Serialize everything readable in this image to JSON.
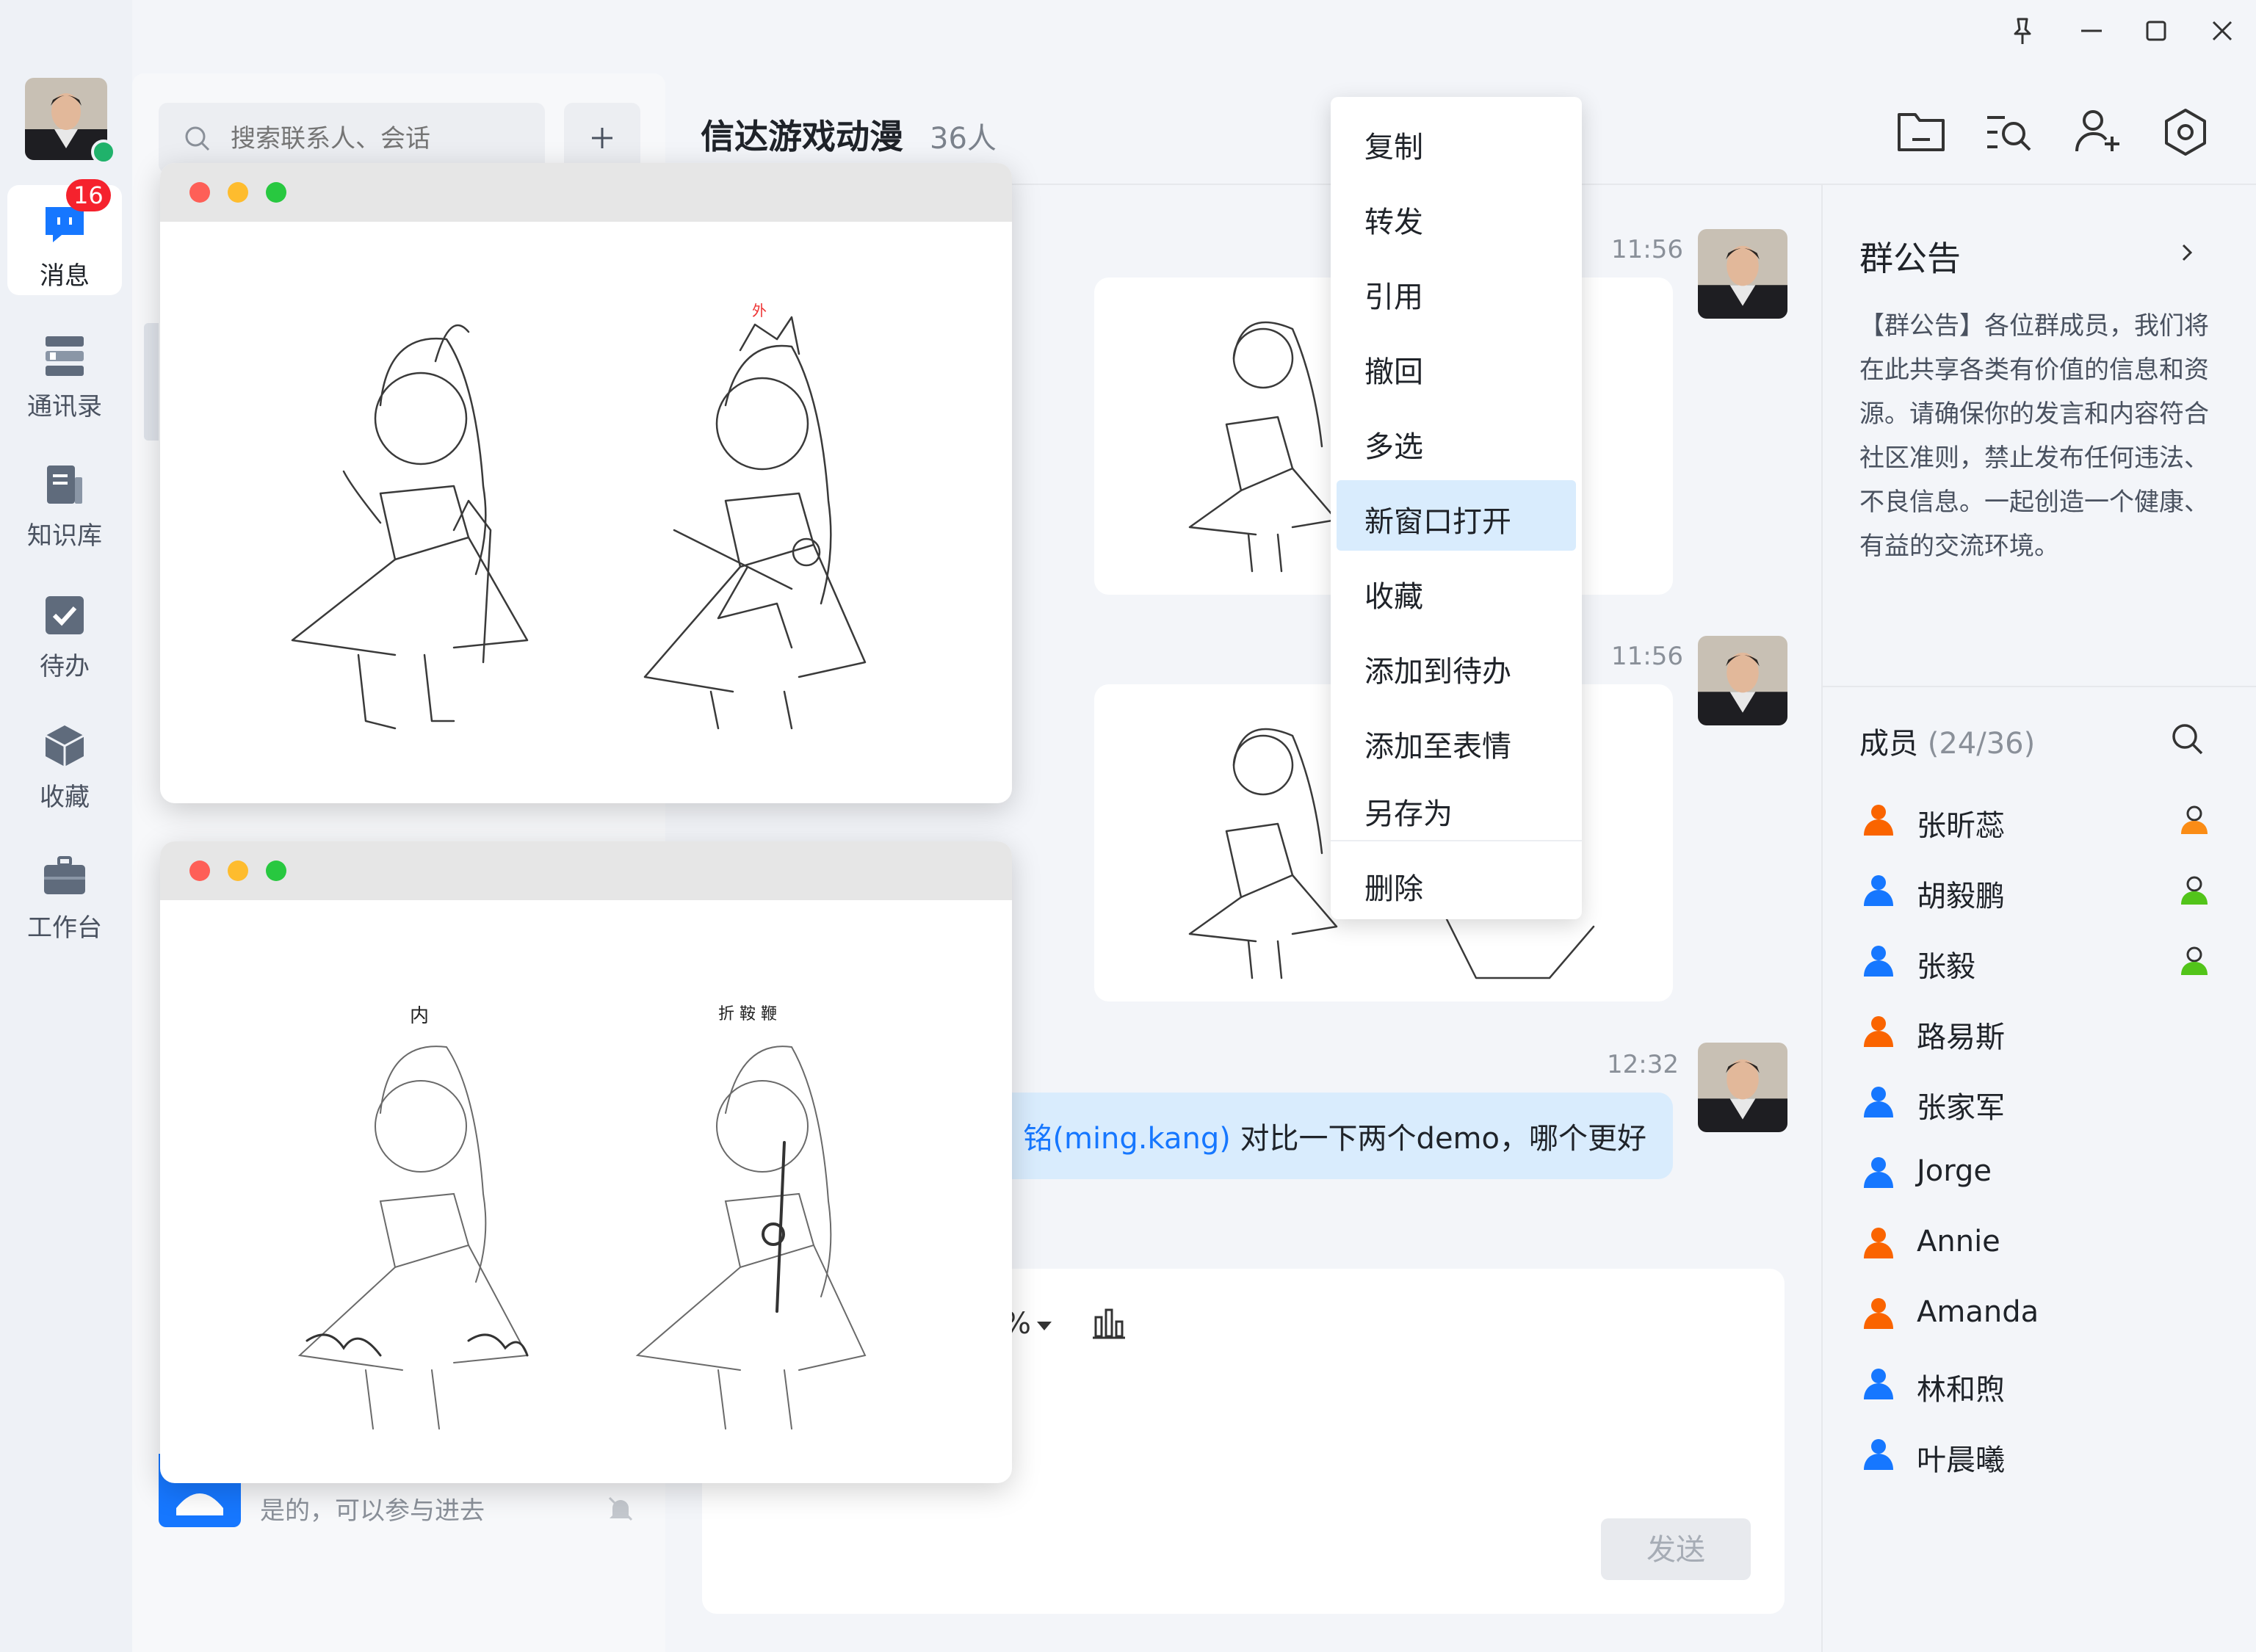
{
  "nav": {
    "badge": "16",
    "items": [
      {
        "label": "消息",
        "icon": "chat-bubble-icon"
      },
      {
        "label": "通讯录",
        "icon": "contacts-icon"
      },
      {
        "label": "知识库",
        "icon": "knowledge-base-icon"
      },
      {
        "label": "待办",
        "icon": "todo-check-icon"
      },
      {
        "label": "收藏",
        "icon": "favorites-box-icon"
      },
      {
        "label": "工作台",
        "icon": "briefcase-icon"
      }
    ]
  },
  "search": {
    "placeholder": "搜索联系人、会话"
  },
  "conversation_list": {
    "partial_preview": "是的，可以参与进去"
  },
  "chat": {
    "title": "信达游戏动漫",
    "member_count": "36人",
    "messages": [
      {
        "time": "11:56"
      },
      {
        "time": "11:56"
      },
      {
        "time": "12:32",
        "mention": "铭(ming.kang)",
        "text": " 对比一下两个demo，哪个更好"
      }
    ],
    "send_label": "发送"
  },
  "context_menu": {
    "items": [
      "复制",
      "转发",
      "引用",
      "撤回",
      "多选",
      "新窗口打开",
      "收藏",
      "添加到待办",
      "添加至表情",
      "另存为",
      "删除"
    ],
    "highlighted": "新窗口打开"
  },
  "announcement": {
    "title": "群公告",
    "text": "【群公告】各位群成员，我们将在此共享各类有价值的信息和资源。请确保你的发言和内容符合社区准则，禁止发布任何违法、不良信息。一起创造一个健康、有益的交流环境。"
  },
  "members": {
    "title": "成员",
    "count": "(24/36)",
    "list": [
      {
        "name": "张昕蕊",
        "color": "#fa6400",
        "role": "orange"
      },
      {
        "name": "胡毅鹏",
        "color": "#1677ff",
        "role": "green"
      },
      {
        "name": "张毅",
        "color": "#1677ff",
        "role": "green"
      },
      {
        "name": "路易斯",
        "color": "#fa6400",
        "role": ""
      },
      {
        "name": "张家军",
        "color": "#1677ff",
        "role": ""
      },
      {
        "name": "Jorge",
        "color": "#1677ff",
        "role": ""
      },
      {
        "name": "Annie",
        "color": "#fa6400",
        "role": ""
      },
      {
        "name": "Amanda",
        "color": "#fa6400",
        "role": ""
      },
      {
        "name": "林和煦",
        "color": "#1677ff",
        "role": ""
      },
      {
        "name": "叶晨曦",
        "color": "#1677ff",
        "role": ""
      }
    ]
  },
  "sketch_labels": {
    "window1_right": "外",
    "window2_left": "内",
    "window2_right": "折 鞍 鞭"
  },
  "colors": {
    "accent": "#1677ff",
    "badge": "#f5222d",
    "online": "#20b26b"
  }
}
